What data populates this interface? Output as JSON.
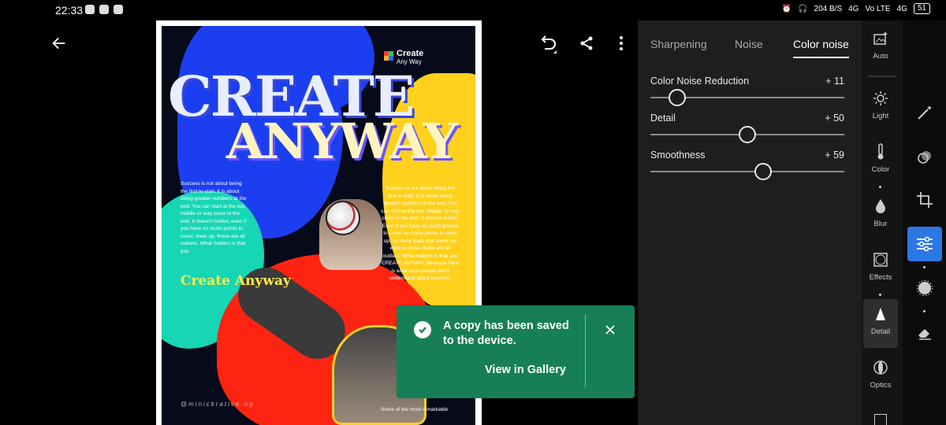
{
  "status_bar": {
    "time": "22:33",
    "network_speed": "204\nB/S",
    "signal_1": "4G",
    "signal_2": "Vo LTE",
    "signal_3": "4G",
    "battery": "51"
  },
  "poster": {
    "logo_line1": "Create",
    "logo_line2": "Any Way",
    "title_line1": "CREATE",
    "title_line2": "ANYWAY",
    "left_text": "Success is not about being the first to start, it is about doing greater numbers at the end. You can start at the top, middle or way close to the end. It doesn't matter, even if you have so much points to cover, meet up, those are all outliers. What matters is that you",
    "right_text": "Success is not about being the first to start. It is about doing greater numbers at the end. You can start at the top, middle, or way close to the end. It doesn't matter. Even if you have so much ground to cover, so many points to meet up, so many gaps that seem too wide to close, those are all outliers. What matters is that you CREATE ANYWAY. Because here is what most people don't understand about success.",
    "create_small": "Create Anyway",
    "credit": "@minickrative.ng",
    "footer_text": "Some of the most remarkable"
  },
  "toast": {
    "message": "A copy has been saved to the device.",
    "action": "View in Gallery",
    "bg_color": "#177f57"
  },
  "panel": {
    "tabs": [
      {
        "label": "Sharpening"
      },
      {
        "label": "Noise"
      },
      {
        "label": "Color noise"
      }
    ],
    "sliders": [
      {
        "label": "Color Noise Reduction",
        "value": "+ 11",
        "level": 0.14
      },
      {
        "label": "Detail",
        "value": "+ 50",
        "level": 0.5
      },
      {
        "label": "Smoothness",
        "value": "+ 59",
        "level": 0.58
      }
    ]
  },
  "tools": [
    {
      "label": "Auto",
      "icon": "auto-photo-icon"
    },
    {
      "label": "Light",
      "icon": "sun-icon"
    },
    {
      "label": "Color",
      "icon": "thermometer-icon"
    },
    {
      "label": "Blur",
      "icon": "drop-icon"
    },
    {
      "label": "Effects",
      "icon": "vignette-icon"
    },
    {
      "label": "Detail",
      "icon": "triangle-icon"
    },
    {
      "label": "Optics",
      "icon": "lens-icon"
    }
  ],
  "side_tools": [
    "magic-wand-icon",
    "heal-icon",
    "crop-icon",
    "edit-sliders-icon",
    "masking-icon",
    "eraser-icon"
  ],
  "accent_color": "#2b78e4"
}
